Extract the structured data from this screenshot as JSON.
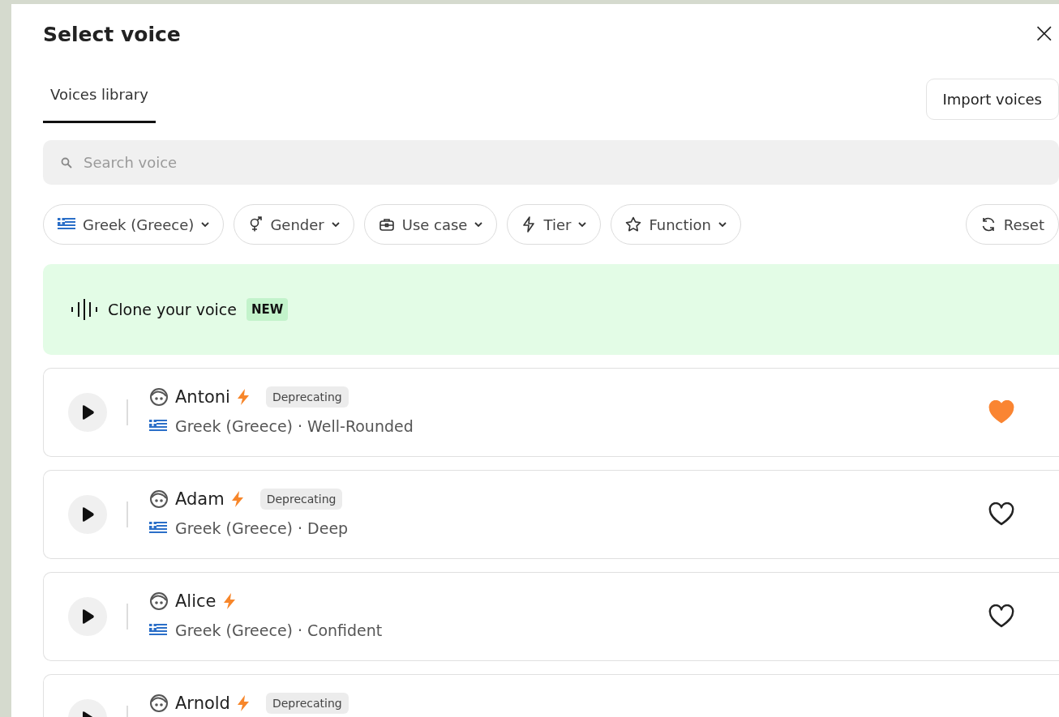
{
  "dialog": {
    "title": "Select voice",
    "close": "×"
  },
  "tabs": [
    {
      "label": "Voices library",
      "selected": true
    }
  ],
  "import_button": "Import voices",
  "search": {
    "placeholder": "Search voice"
  },
  "filters": [
    {
      "label": "Greek (Greece)",
      "kind": "flag"
    },
    {
      "label": "Gender",
      "kind": "gender"
    },
    {
      "label": "Use case",
      "kind": "case"
    },
    {
      "label": "Tier",
      "kind": "bolt"
    },
    {
      "label": "Function",
      "kind": "star"
    }
  ],
  "reset": "Reset",
  "clone_banner": {
    "label": "Clone your voice",
    "badge": "NEW"
  },
  "voices": [
    {
      "name": "Antoni",
      "badge": "Deprecating",
      "details": "Greek (Greece) · Well-Rounded",
      "favorite": true
    },
    {
      "name": "Adam",
      "badge": "Deprecating",
      "details": "Greek (Greece) · Deep",
      "favorite": false
    },
    {
      "name": "Alice",
      "details": "Greek (Greece) · Confident",
      "favorite": false
    },
    {
      "name": "Arnold",
      "badge": "Deprecating"
    }
  ]
}
